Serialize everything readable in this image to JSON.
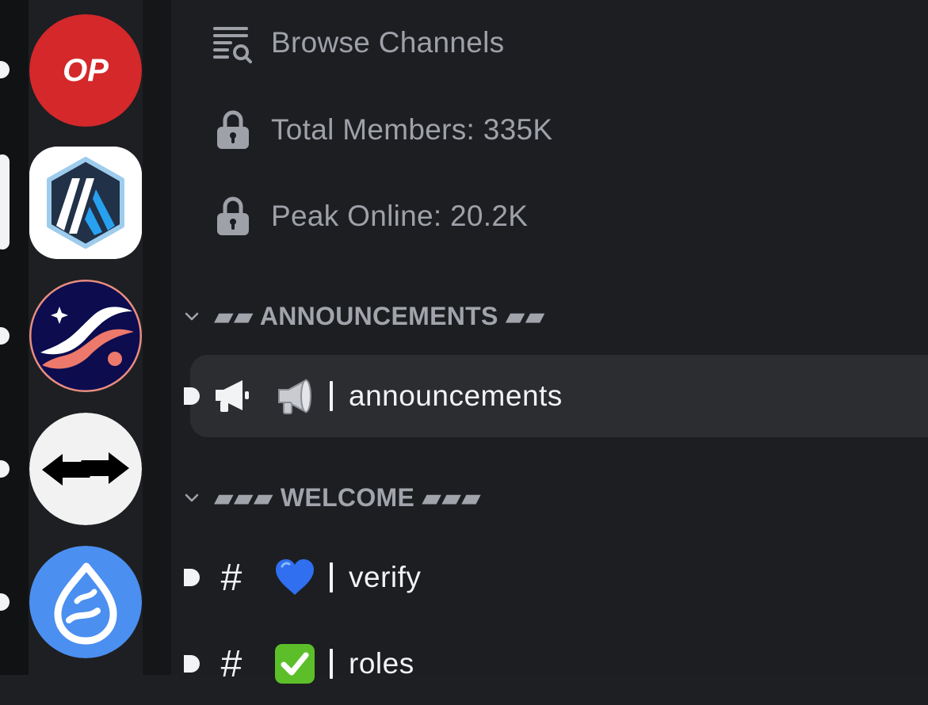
{
  "servers": [
    {
      "name": "Optimism",
      "badge_text": "OP",
      "icon": "optimism-logo",
      "indicator": "unread",
      "color": "#d4282b"
    },
    {
      "name": "Arbitrum",
      "icon": "arbitrum-logo",
      "indicator": "selected",
      "color": "#213147"
    },
    {
      "name": "Starknet",
      "icon": "starknet-logo",
      "indicator": "unread",
      "color": "#0c0c4f"
    },
    {
      "name": "Swap server",
      "icon": "swap-arrows-logo",
      "indicator": "unread",
      "color": "#f2f2f2"
    },
    {
      "name": "Sui",
      "icon": "sui-drop-logo",
      "indicator": "unread",
      "color": "#4b8ff0"
    }
  ],
  "top_items": [
    {
      "icon": "browse-channels-icon",
      "label": "Browse Channels"
    },
    {
      "icon": "lock-icon",
      "label": "Total Members: 335K"
    },
    {
      "icon": "lock-icon",
      "label": "Peak Online: 20.2K"
    }
  ],
  "categories": {
    "announcements": {
      "label": "▰▰ ANNOUNCEMENTS ▰▰",
      "collapsed": false
    },
    "welcome": {
      "label": "▰▰▰ WELCOME ▰▰▰",
      "collapsed": false
    }
  },
  "channels": {
    "announcements": {
      "glyph_icon": "megaphone-icon",
      "emoji": "📢",
      "name": "announcements",
      "selected": true,
      "unread": true
    },
    "verify": {
      "glyph": "#",
      "emoji": "💙",
      "name": "verify",
      "unread": true
    },
    "roles": {
      "glyph": "#",
      "emoji": "✅",
      "name": "roles",
      "unread": true
    }
  },
  "colors": {
    "background": "#1e1f22",
    "selected_row": "#2b2d31",
    "text_primary": "#f2f3f5",
    "text_muted": "#9ea1a8"
  }
}
